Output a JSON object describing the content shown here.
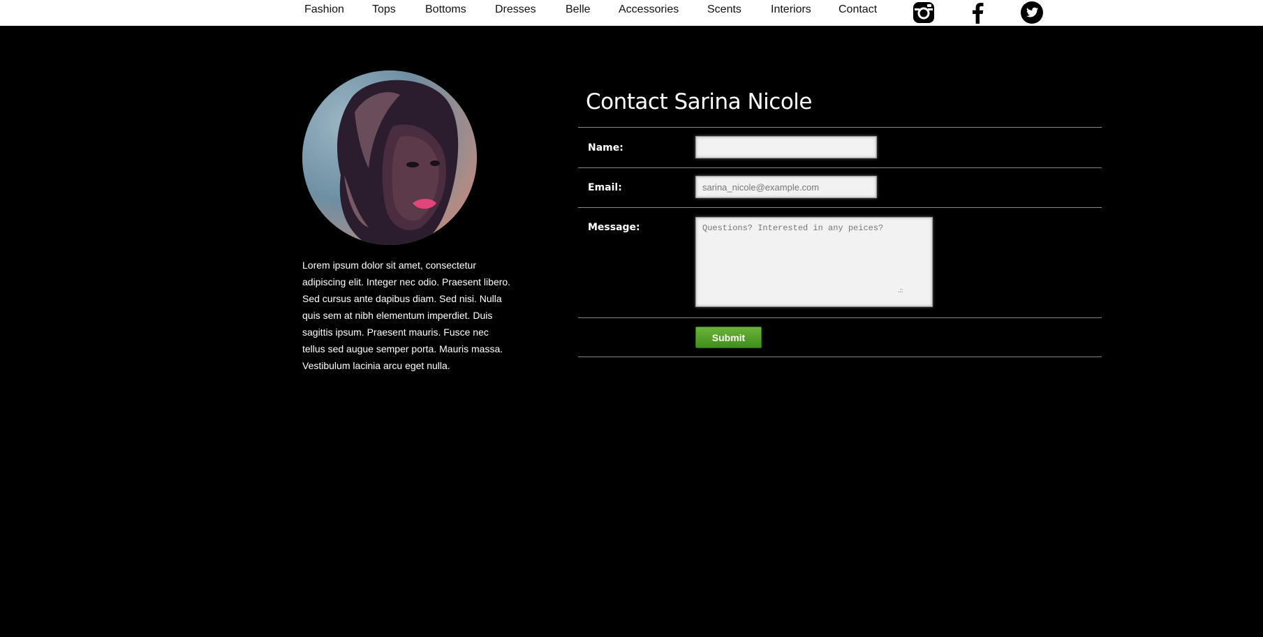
{
  "nav": {
    "items": [
      {
        "label": "Fashion"
      },
      {
        "label": "Tops"
      },
      {
        "label": "Bottoms"
      },
      {
        "label": "Dresses"
      },
      {
        "label": "Belle"
      },
      {
        "label": "Accessories"
      },
      {
        "label": "Scents"
      },
      {
        "label": "Interiors"
      },
      {
        "label": "Contact"
      }
    ],
    "social_icons": [
      "instagram-icon",
      "facebook-icon",
      "twitter-icon"
    ]
  },
  "profile": {
    "bio": "Lorem ipsum dolor sit amet, consectetur adipiscing elit. Integer nec odio. Praesent libero. Sed cursus ante dapibus diam. Sed nisi. Nulla quis sem at nibh elementum imperdiet. Duis sagittis ipsum. Praesent mauris. Fusce nec tellus sed augue semper porta. Mauris massa. Vestibulum lacinia arcu eget nulla."
  },
  "form": {
    "title": "Contact Sarina Nicole",
    "name_label": "Name:",
    "name_value": "",
    "email_label": "Email:",
    "email_placeholder": "sarina_nicole@example.com",
    "message_label": "Message:",
    "message_placeholder": "Questions? Interested in any peices?",
    "submit_label": "Submit"
  },
  "colors": {
    "background": "#000000",
    "nav_background": "#ffffff",
    "submit_green": "#4f9e25"
  }
}
